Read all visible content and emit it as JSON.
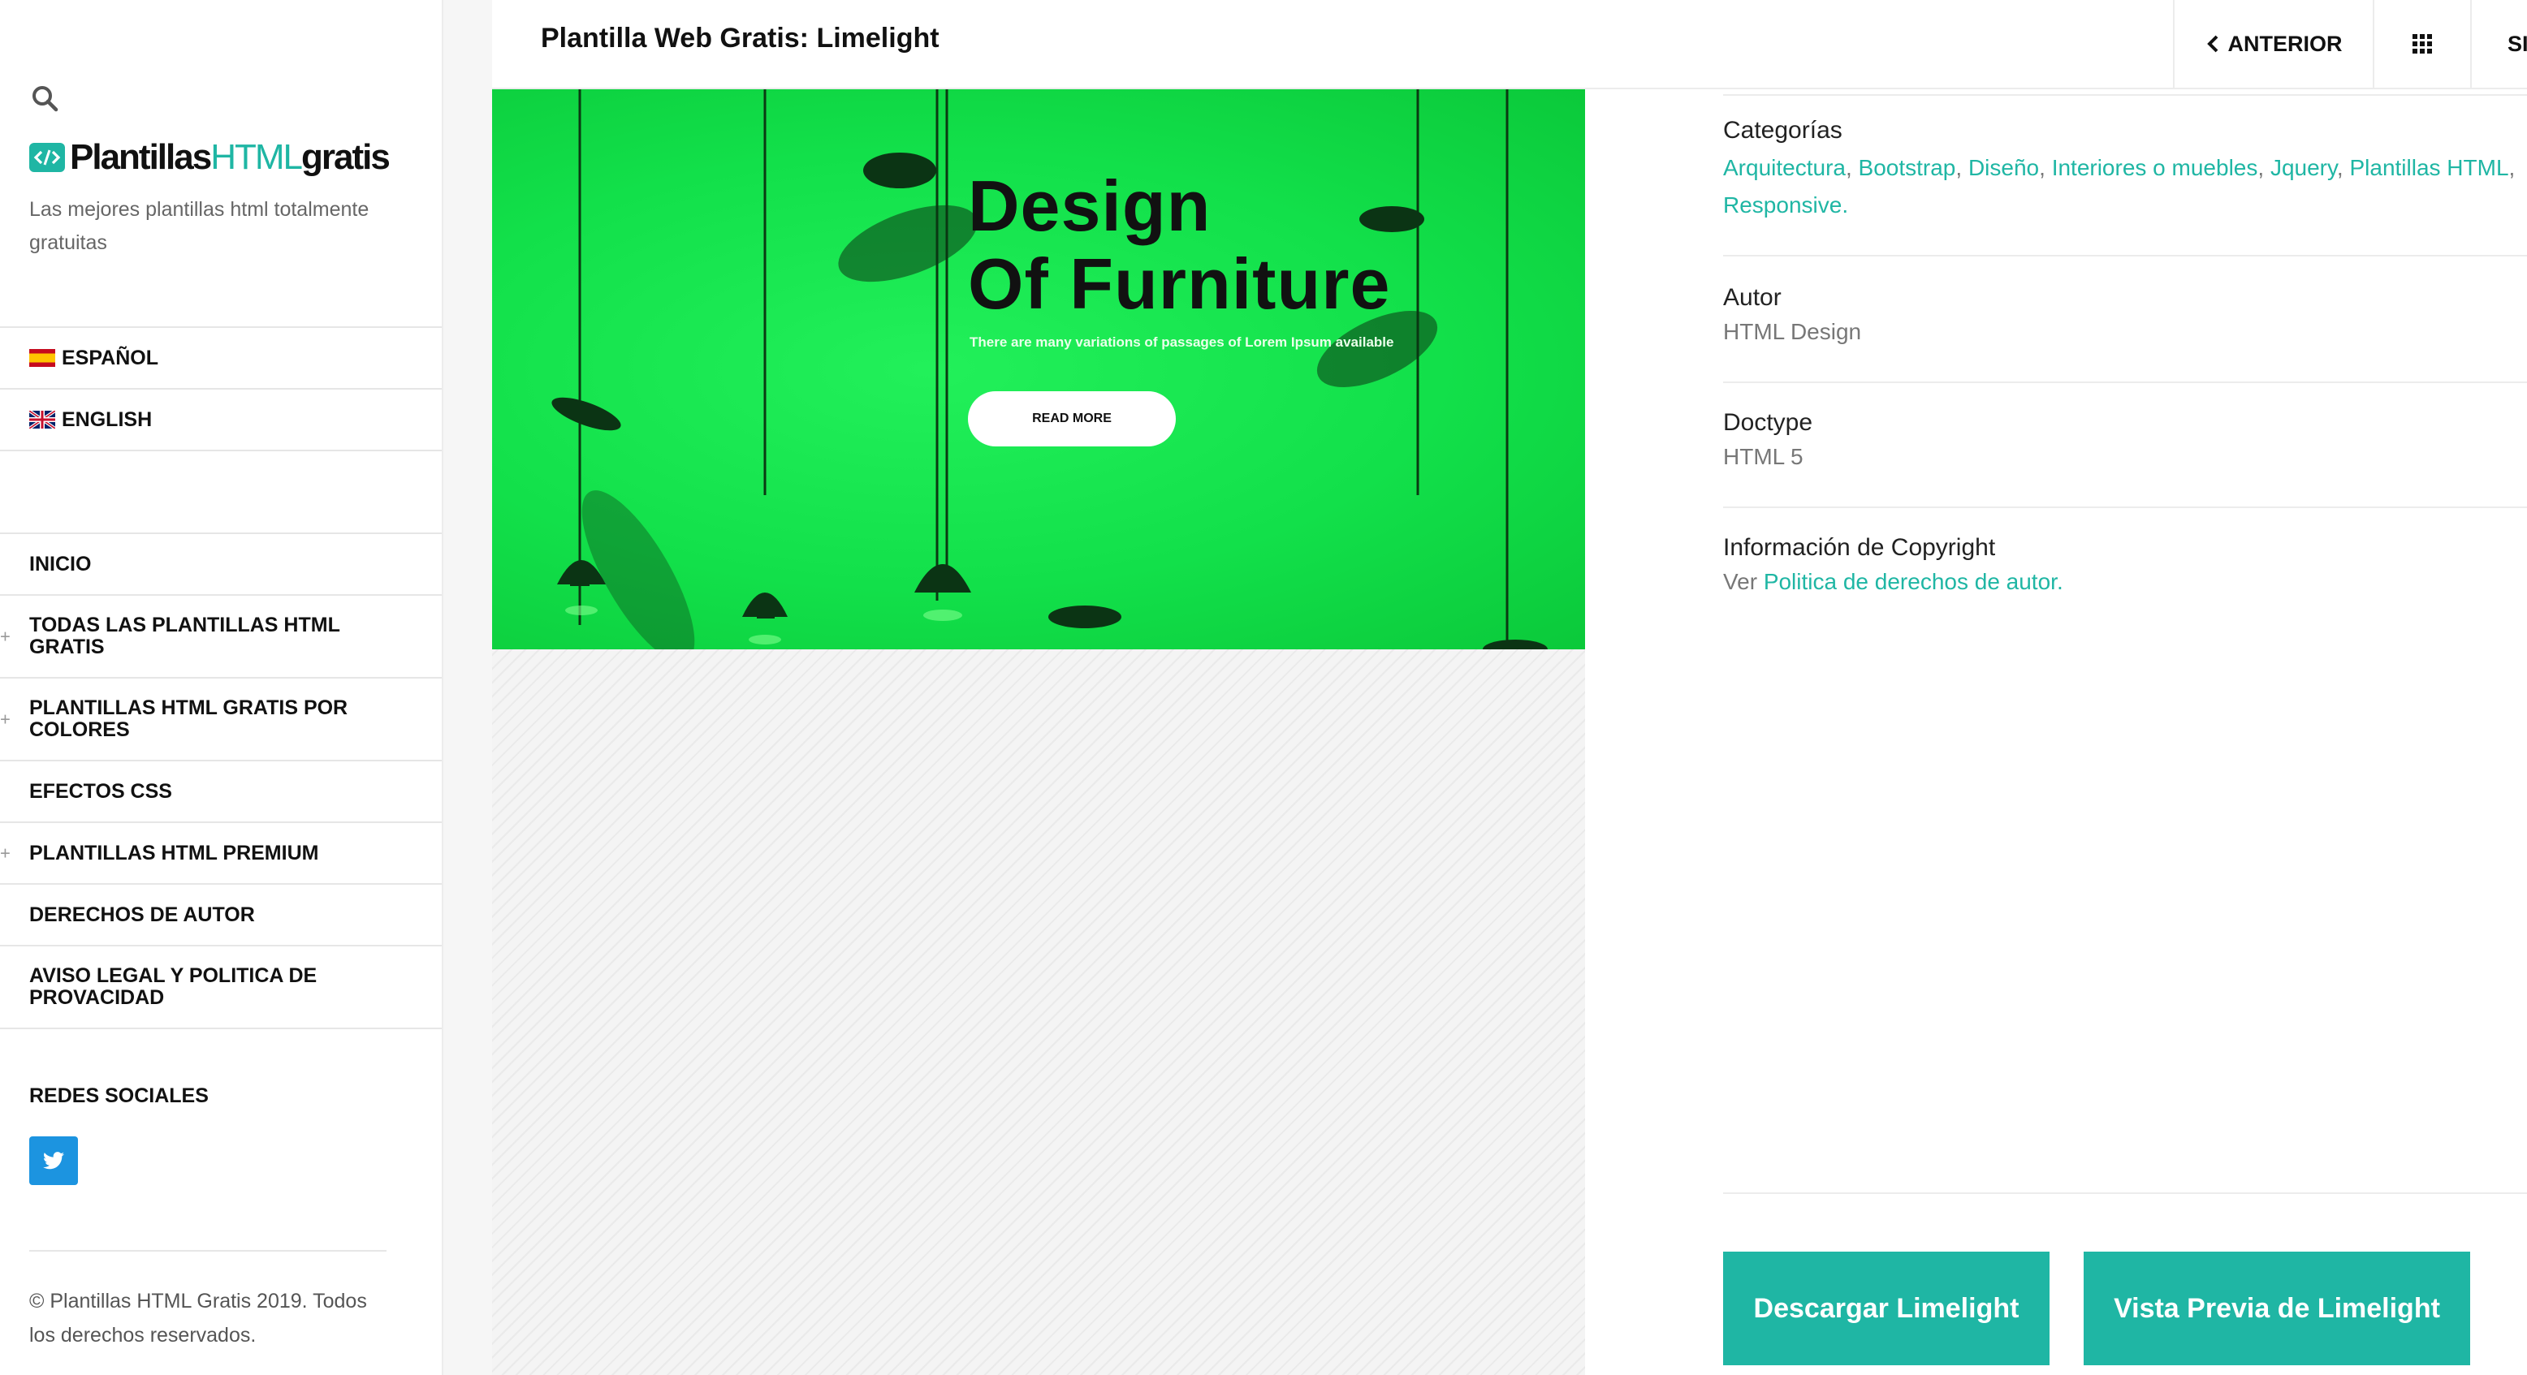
{
  "sidebar": {
    "logo": {
      "part1": "Plantillas",
      "part2": "HTML",
      "part3": "gratis"
    },
    "tagline": "Las mejores plantillas html totalmente gratuitas",
    "languages": [
      {
        "label": "ESPAÑOL",
        "flag": "spain-flag-icon"
      },
      {
        "label": "ENGLISH",
        "flag": "uk-flag-icon"
      }
    ],
    "nav": [
      {
        "label": "INICIO",
        "expandable": false
      },
      {
        "label": "TODAS LAS PLANTILLAS HTML GRATIS",
        "expandable": true
      },
      {
        "label": "PLANTILLAS HTML GRATIS POR COLORES",
        "expandable": true
      },
      {
        "label": "EFECTOS CSS",
        "expandable": false
      },
      {
        "label": "PLANTILLAS HTML PREMIUM",
        "expandable": true
      },
      {
        "label": "DERECHOS DE AUTOR",
        "expandable": false
      },
      {
        "label": "AVISO LEGAL Y POLITICA DE PROVACIDAD",
        "expandable": false
      }
    ],
    "social_title": "REDES SOCIALES",
    "copyright": "© Plantillas HTML Gratis 2019. Todos los derechos reservados."
  },
  "header": {
    "title": "Plantilla Web Gratis: Limelight",
    "prev_label": "ANTERIOR",
    "next_label": "SIGUIENTE"
  },
  "preview": {
    "title_line1": "Design",
    "title_line2": "Of Furniture",
    "subtitle": "There are many variations of passages of Lorem Ipsum available",
    "button": "READ MORE"
  },
  "info": {
    "categories_label": "Categorías",
    "categories": [
      "Arquitectura",
      "Bootstrap",
      "Diseño",
      "Interiores o muebles",
      "Jquery",
      "Plantillas HTML",
      "Responsive"
    ],
    "author_label": "Autor",
    "author": "HTML Design",
    "doctype_label": "Doctype",
    "doctype": "HTML 5",
    "copyright_label": "Información de Copyright",
    "copyright_prefix": "Ver",
    "copyright_link": "Politica de derechos de autor."
  },
  "actions": {
    "download": "Descargar Limelight",
    "preview": "Vista Previa de Limelight"
  },
  "colors": {
    "accent": "#1fb6a4",
    "hero_green": "#12e04a",
    "twitter": "#1c94e0"
  }
}
